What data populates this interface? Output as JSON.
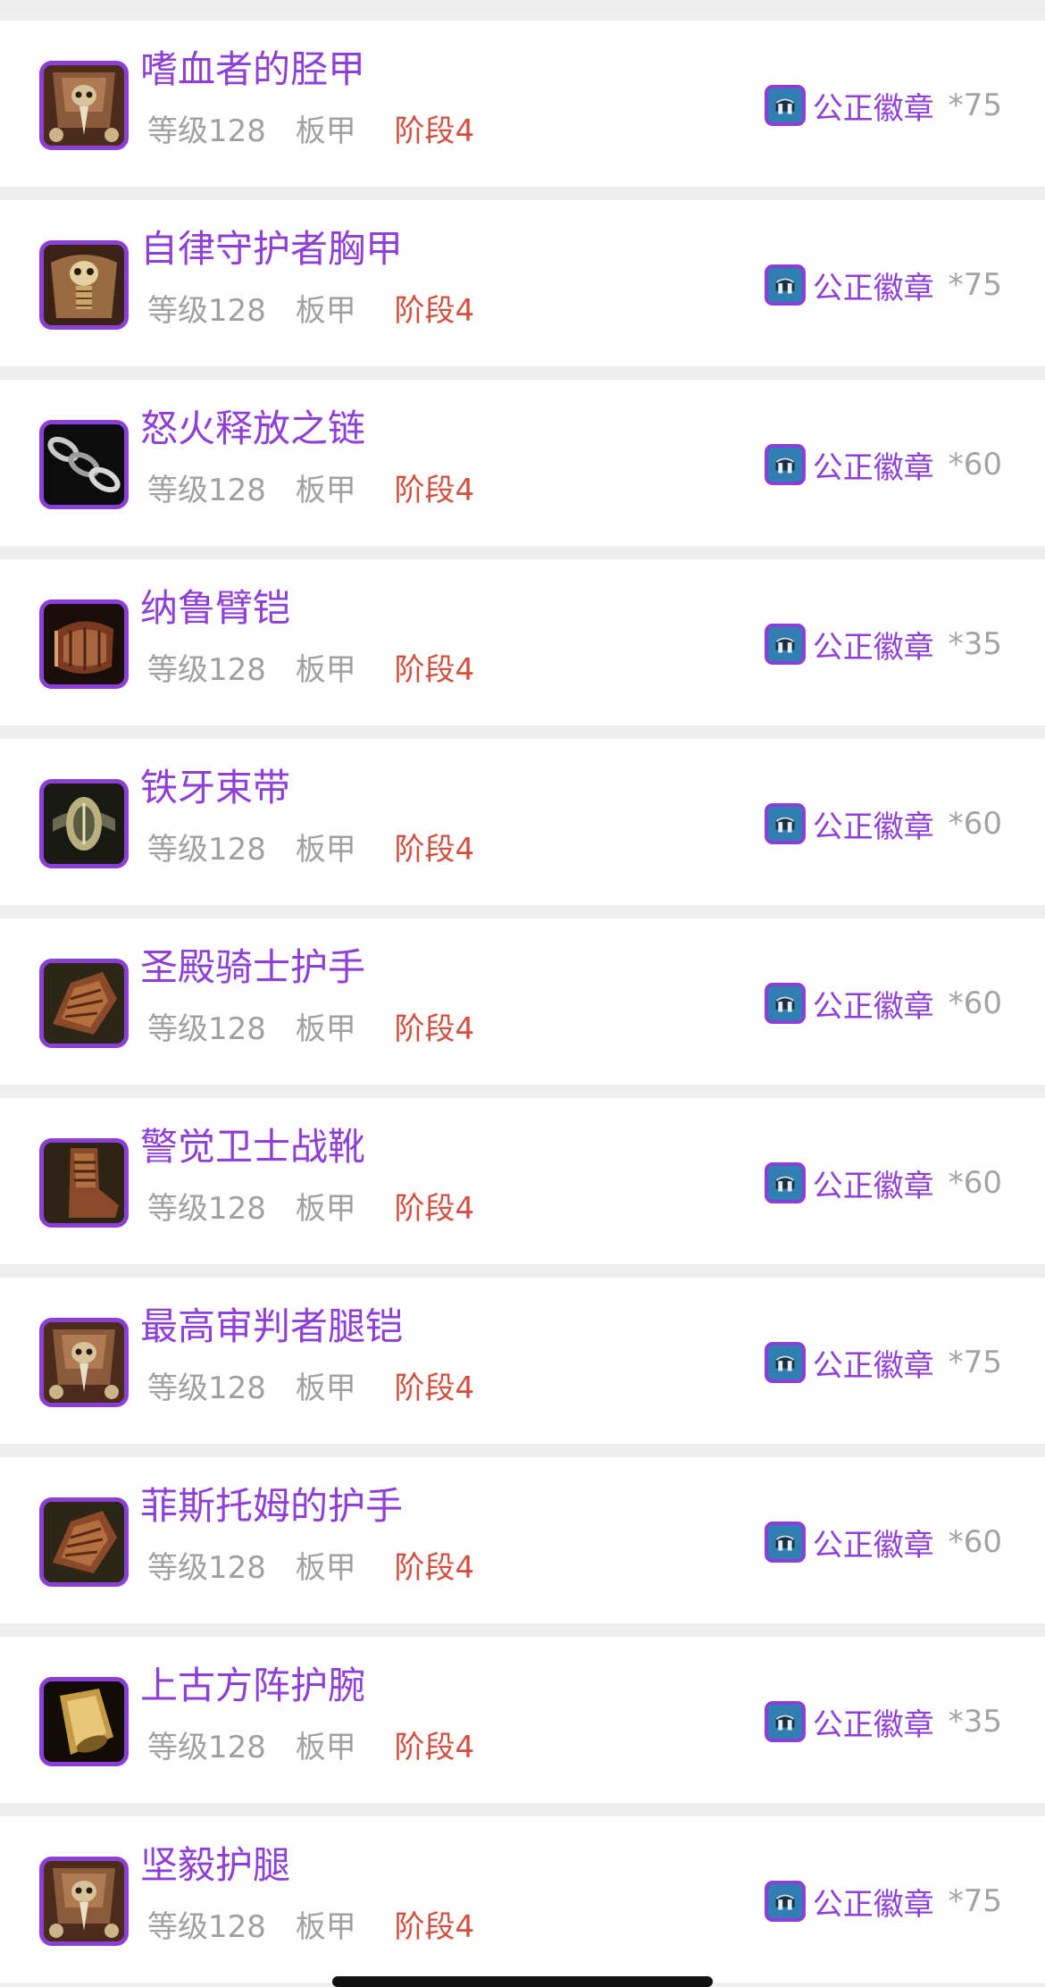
{
  "items": [
    {
      "name": "嗜血者的胫甲",
      "level": "等级128",
      "armor": "板甲",
      "phase": "阶段4",
      "currency": "公正徽章",
      "qty": "*75",
      "icon": "legs-skull-icon"
    },
    {
      "name": "自律守护者胸甲",
      "level": "等级128",
      "armor": "板甲",
      "phase": "阶段4",
      "currency": "公正徽章",
      "qty": "*75",
      "icon": "chest-armor-icon"
    },
    {
      "name": "怒火释放之链",
      "level": "等级128",
      "armor": "板甲",
      "phase": "阶段4",
      "currency": "公正徽章",
      "qty": "*60",
      "icon": "chain-icon"
    },
    {
      "name": "纳鲁臂铠",
      "level": "等级128",
      "armor": "板甲",
      "phase": "阶段4",
      "currency": "公正徽章",
      "qty": "*35",
      "icon": "bracer-icon"
    },
    {
      "name": "铁牙束带",
      "level": "等级128",
      "armor": "板甲",
      "phase": "阶段4",
      "currency": "公正徽章",
      "qty": "*60",
      "icon": "belt-icon"
    },
    {
      "name": "圣殿骑士护手",
      "level": "等级128",
      "armor": "板甲",
      "phase": "阶段4",
      "currency": "公正徽章",
      "qty": "*60",
      "icon": "gauntlet-icon"
    },
    {
      "name": "警觉卫士战靴",
      "level": "等级128",
      "armor": "板甲",
      "phase": "阶段4",
      "currency": "公正徽章",
      "qty": "*60",
      "icon": "boots-icon"
    },
    {
      "name": "最高审判者腿铠",
      "level": "等级128",
      "armor": "板甲",
      "phase": "阶段4",
      "currency": "公正徽章",
      "qty": "*75",
      "icon": "legs-skull-icon"
    },
    {
      "name": "菲斯托姆的护手",
      "level": "等级128",
      "armor": "板甲",
      "phase": "阶段4",
      "currency": "公正徽章",
      "qty": "*60",
      "icon": "gauntlet-icon"
    },
    {
      "name": "上古方阵护腕",
      "level": "等级128",
      "armor": "板甲",
      "phase": "阶段4",
      "currency": "公正徽章",
      "qty": "*35",
      "icon": "golden-bracer-icon"
    },
    {
      "name": "坚毅护腿",
      "level": "等级128",
      "armor": "板甲",
      "phase": "阶段4",
      "currency": "公正徽章",
      "qty": "*75",
      "icon": "legs-skull-icon"
    }
  ],
  "colors": {
    "item_name": "#8e3fd8",
    "phase": "#d24f3f",
    "muted": "#a0a0a0",
    "icon_border": "#8c3fd6",
    "badge": "#2f7fb2"
  }
}
